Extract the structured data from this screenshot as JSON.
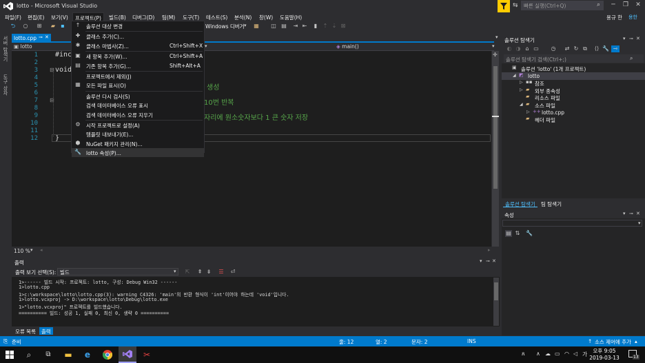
{
  "window": {
    "title": "lotto - Microsoft Visual Studio",
    "quick_launch_placeholder": "빠른 실행(Ctrl+Q)",
    "user": "용규 한",
    "user_badge": "용한"
  },
  "menubar": [
    "파일(F)",
    "편집(E)",
    "보기(V)",
    "프로젝트(P)",
    "빌드(B)",
    "디버그(D)",
    "팀(M)",
    "도구(T)",
    "테스트(S)",
    "분석(N)",
    "창(W)",
    "도움말(H)"
  ],
  "toolbar": {
    "platform_label": "Windows 디버거"
  },
  "project_menu": {
    "items": [
      {
        "icon": "arrow-up-icon",
        "label": "솔루션 대상 변경",
        "shortcut": ""
      },
      {
        "sep": true
      },
      {
        "icon": "add-class-icon",
        "label": "클래스 추가(C)...",
        "shortcut": ""
      },
      {
        "icon": "class-wizard-icon",
        "label": "클래스 마법사(Z)...",
        "shortcut": "Ctrl+Shift+X"
      },
      {
        "sep": true
      },
      {
        "icon": "new-item-icon",
        "label": "새 항목 추가(W)...",
        "shortcut": "Ctrl+Shift+A"
      },
      {
        "icon": "existing-item-icon",
        "label": "기존 항목 추가(G)...",
        "shortcut": "Shift+Alt+A"
      },
      {
        "sep": true
      },
      {
        "icon": "",
        "label": "프로젝트에서 제외(J)",
        "shortcut": ""
      },
      {
        "icon": "show-all-files-icon",
        "label": "모든 파일 표시(O)",
        "shortcut": ""
      },
      {
        "sep": true
      },
      {
        "icon": "",
        "label": "솔루션 다시 검사(S)",
        "shortcut": ""
      },
      {
        "icon": "",
        "label": "검색 데이터베이스 오류 표시",
        "shortcut": ""
      },
      {
        "icon": "",
        "label": "검색 데이터베이스 오류 지우기",
        "shortcut": ""
      },
      {
        "sep": true
      },
      {
        "icon": "gear-icon",
        "label": "시작 프로젝트로 설정(A)",
        "shortcut": ""
      },
      {
        "icon": "",
        "label": "템플릿 내보내기(E)...",
        "shortcut": ""
      },
      {
        "icon": "nuget-icon",
        "label": "NuGet 패키지 관리(N)...",
        "shortcut": ""
      },
      {
        "icon": "wrench-icon",
        "label": "lotto 속성(P)...",
        "shortcut": "",
        "highlighted": true
      }
    ]
  },
  "editor": {
    "tab_label": "lotto.cpp",
    "nav_project": "lotto",
    "nav_function": "main()",
    "zoom": "110 %",
    "lines": [
      {
        "no": "1",
        "code": "#inc"
      },
      {
        "no": "2",
        "code": ""
      },
      {
        "no": "3",
        "code": "void"
      },
      {
        "no": "4",
        "code": ""
      },
      {
        "no": "5",
        "code": "",
        "comment": "생성"
      },
      {
        "no": "6",
        "code": ""
      },
      {
        "no": "7",
        "code": "",
        "comment": "10번 반복"
      },
      {
        "no": "8",
        "code": ""
      },
      {
        "no": "9",
        "code": "",
        "comment": "자리에 원소숫자보다 1 큰 숫자 저장"
      },
      {
        "no": "10",
        "code": ""
      },
      {
        "no": "11",
        "code": ""
      },
      {
        "no": "12",
        "code": "}"
      }
    ]
  },
  "output": {
    "title": "출력",
    "source_label": "출력 보기 선택(S):",
    "source_value": "빌드",
    "lines": [
      "1>------ 빌드 시작: 프로젝트: lotto, 구성: Debug Win32 ------",
      "1>lotto.cpp",
      "1>c:\\workspace\\lotto\\lotto.cpp(3): warning C4326: 'main'의 반환 형식이 'int'이어야 하는데 'void'입니다.",
      "1>lotto.vcxproj -> D:\\workspace\\lotto\\Debug\\lotto.exe",
      "1>\"lotto.vcxproj\" 프로젝트를 빌드했습니다.",
      "========== 빌드: 성공 1, 실패 0, 최신 0, 생략 0 =========="
    ],
    "bottom_tabs": [
      "오류 목록",
      "출력"
    ]
  },
  "solution_explorer": {
    "title": "솔루션 탐색기",
    "search_placeholder": "솔루션 탐색기 검색(Ctrl+;)",
    "tree": [
      {
        "label": "솔루션 'lotto' (1개 프로젝트)",
        "indent": 0,
        "icon": "solution-icon",
        "arrow": ""
      },
      {
        "label": "lotto",
        "indent": 1,
        "icon": "project-icon",
        "arrow": "◢",
        "selected": true
      },
      {
        "label": "참조",
        "indent": 2,
        "icon": "references-icon",
        "arrow": "▷"
      },
      {
        "label": "외부 종속성",
        "indent": 2,
        "icon": "folder-icon",
        "arrow": "▷"
      },
      {
        "label": "리소스 파일",
        "indent": 2,
        "icon": "folder-icon",
        "arrow": ""
      },
      {
        "label": "소스 파일",
        "indent": 2,
        "icon": "folder-icon",
        "arrow": "◢"
      },
      {
        "label": "lotto.cpp",
        "indent": 3,
        "icon": "cpp-file-icon",
        "arrow": "▷"
      },
      {
        "label": "헤더 파일",
        "indent": 2,
        "icon": "folder-icon",
        "arrow": ""
      }
    ],
    "tabs": [
      "솔루션 탐색기",
      "팀 탐색기"
    ]
  },
  "properties": {
    "title": "속성"
  },
  "left_tabs": [
    "서버 탐색기",
    "도구 상자"
  ],
  "statusbar": {
    "ready": "준비",
    "line": "줄: 12",
    "col": "열: 2",
    "ch": "문자: 2",
    "ins": "INS",
    "source_control": "소스 제어에 추가"
  },
  "taskbar": {
    "time": "오후 9:05",
    "date": "2019-03-13",
    "ime": "가",
    "notification_count": "13"
  },
  "colors": {
    "accent": "#007acc",
    "comment": "#57a64a",
    "line_number": "#2b91af",
    "filter_yellow": "#ffcc00"
  }
}
